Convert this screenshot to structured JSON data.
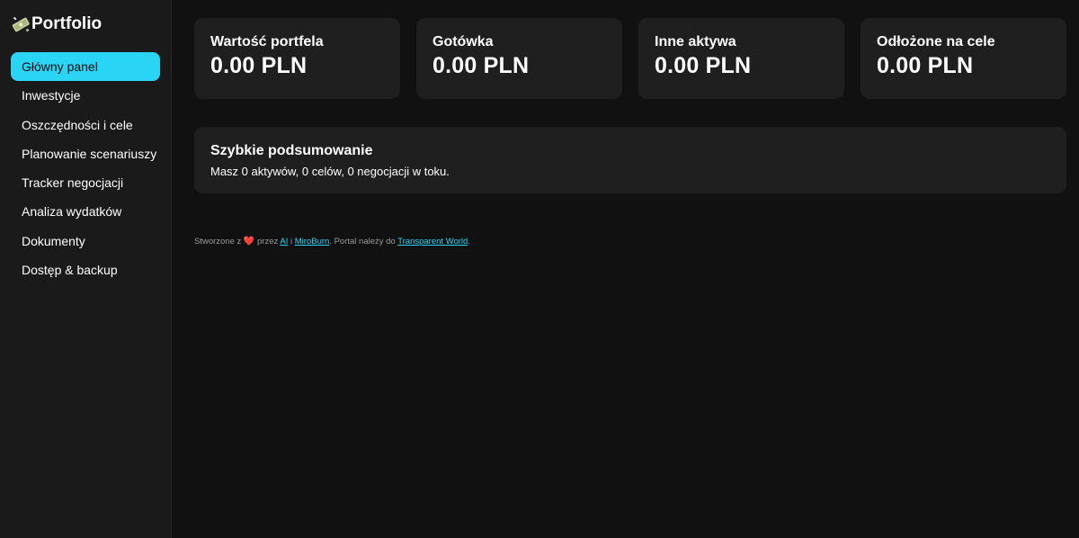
{
  "sidebar": {
    "brand": {
      "icon": "money-icon",
      "title": "Portfolio"
    },
    "items": [
      {
        "label": "Główny panel",
        "active": true
      },
      {
        "label": "Inwestycje"
      },
      {
        "label": "Oszczędności i cele"
      },
      {
        "label": "Planowanie scenariuszy"
      },
      {
        "label": "Tracker negocjacji"
      },
      {
        "label": "Analiza wydatków"
      },
      {
        "label": "Dokumenty"
      },
      {
        "label": "Dostęp & backup"
      }
    ]
  },
  "cards": [
    {
      "label": "Wartość portfela",
      "value": "0.00 PLN"
    },
    {
      "label": "Gotówka",
      "value": "0.00 PLN"
    },
    {
      "label": "Inne aktywa",
      "value": "0.00 PLN"
    },
    {
      "label": "Odłożone na cele",
      "value": "0.00 PLN"
    }
  ],
  "summary": {
    "title": "Szybkie podsumowanie",
    "text": "Masz 0 aktywów, 0 celów, 0 negocjacji w toku."
  },
  "footer": {
    "prefix": "Stworzone z",
    "heart": "❤️",
    "przez": "przez",
    "link_ai": "AI",
    "and": "i",
    "link_miroburn": "MiroBurn",
    "middle": ". Portal należy do",
    "link_tw": "Transparent World",
    "suffix": "."
  },
  "colors": {
    "accent": "#2ad4f5",
    "background": "#111111",
    "sidebar": "#1a1a1a",
    "card": "#1f1f1f"
  }
}
